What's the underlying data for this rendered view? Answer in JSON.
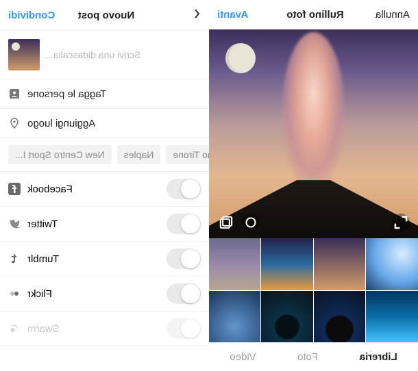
{
  "left": {
    "header": {
      "cancel": "Annulla",
      "title": "Rullino foto",
      "next": "Avanti"
    },
    "tabs": {
      "library": "Libreria",
      "photo": "Foto",
      "video": "Video"
    }
  },
  "right": {
    "header": {
      "title": "Nuovo post",
      "share": "Condividi"
    },
    "caption_placeholder": "Scrivi una didascalia...",
    "tag_people": "Tagga le persone",
    "add_location": "Aggiungi luogo",
    "location_suggestions": [
      "Agriturismo Tirone",
      "Naples",
      "New Centro Sport I..."
    ],
    "shares": [
      {
        "name": "Facebook",
        "enabled": true
      },
      {
        "name": "Twitter",
        "enabled": true
      },
      {
        "name": "Tumblr",
        "enabled": true
      },
      {
        "name": "Flickr",
        "enabled": true
      },
      {
        "name": "Swarm",
        "enabled": false
      }
    ]
  }
}
